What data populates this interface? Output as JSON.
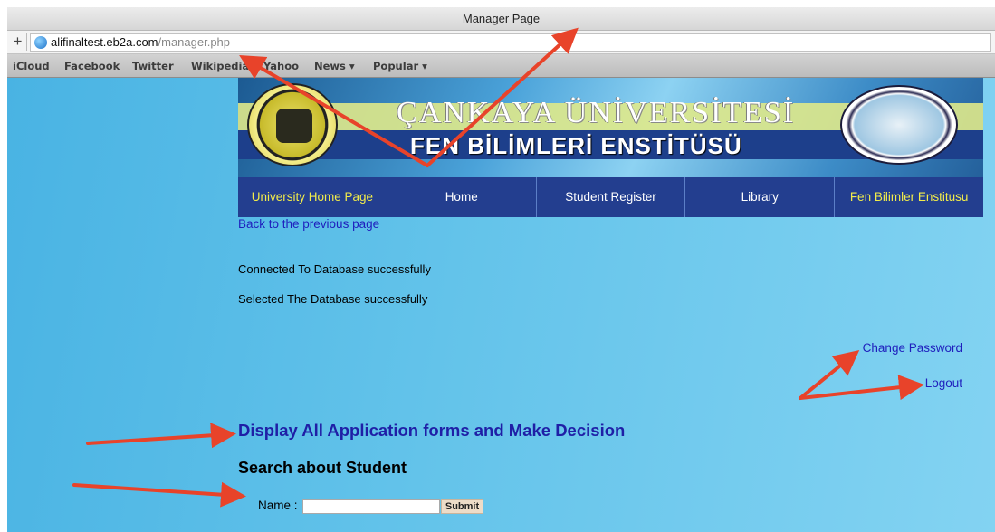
{
  "browser": {
    "window_title": "Manager Page",
    "url_host": "alifinaltest.eb2a.com",
    "url_path": "/manager.php",
    "bookmarks": [
      "iCloud",
      "Facebook",
      "Twitter",
      "Wikipedia",
      "Yahoo",
      "News ▾",
      "Popular ▾"
    ]
  },
  "banner": {
    "title_line1": "ÇANKAYA ÜNİVERSİTESİ",
    "title_line2": "FEN BİLİMLERİ ENSTİTÜSÜ"
  },
  "nav": {
    "items": [
      "University Home Page",
      "Home",
      "Student Register",
      "Library",
      "Fen Bilimler Enstitusu"
    ]
  },
  "page": {
    "back_link": "Back to the previous page",
    "status_lines": [
      "Connected To Database successfully",
      "Selected The Database successfully"
    ],
    "change_password": "Change Password",
    "logout": "Logout",
    "display_link": "Display All Application forms and Make Decision",
    "search_heading": "Search about Student",
    "name_label": "Name :",
    "name_value": "",
    "submit_label": "Submit"
  },
  "colors": {
    "page_background": "#63c3ea",
    "nav_background": "#233e8f",
    "link": "#1f1fbd",
    "annotation_arrow": "#e8432a"
  }
}
